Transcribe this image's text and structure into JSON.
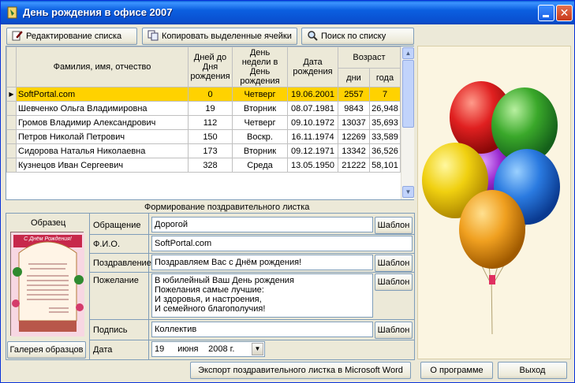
{
  "window": {
    "title": "День рождения в офисе 2007"
  },
  "toolbar": {
    "edit_list": "Редактирование списка",
    "copy_cells": "Копировать выделенные ячейки",
    "search": "Поиск по списку"
  },
  "grid": {
    "headers": {
      "name": "Фамилия, имя, отчество",
      "days_to_bday": "Дней до Дня рождения",
      "weekday": "День недели в День рождения",
      "birth_date": "Дата рождения",
      "age": "Возраст",
      "age_days": "дни",
      "age_years": "года"
    },
    "rows": [
      {
        "name": "SoftPortal.com",
        "days": "0",
        "weekday": "Четверг",
        "date": "19.06.2001",
        "age_days": "2557",
        "age_years": "7"
      },
      {
        "name": "Шевченко Ольга Владимировна",
        "days": "19",
        "weekday": "Вторник",
        "date": "08.07.1981",
        "age_days": "9843",
        "age_years": "26,948"
      },
      {
        "name": "Громов Владимир Александрович",
        "days": "112",
        "weekday": "Четверг",
        "date": "09.10.1972",
        "age_days": "13037",
        "age_years": "35,693"
      },
      {
        "name": "Петров Николай Петрович",
        "days": "150",
        "weekday": "Воскр.",
        "date": "16.11.1974",
        "age_days": "12269",
        "age_years": "33,589"
      },
      {
        "name": "Сидорова Наталья Николаевна",
        "days": "173",
        "weekday": "Вторник",
        "date": "09.12.1971",
        "age_days": "13342",
        "age_years": "36,526"
      },
      {
        "name": "Кузнецов Иван Сергеевич",
        "days": "328",
        "weekday": "Среда",
        "date": "13.05.1950",
        "age_days": "21222",
        "age_years": "58,101"
      }
    ]
  },
  "card": {
    "section_title": "Формирование поздравительного листка",
    "sample_label": "Образец",
    "gallery_button": "Галерея образцов",
    "template_button": "Шаблон",
    "fields": {
      "greeting_label": "Обращение",
      "greeting_value": "Дорогой",
      "fio_label": "Ф.И.О.",
      "fio_value": "SoftPortal.com",
      "congrats_label": "Поздравление",
      "congrats_value": "Поздравляем Вас с Днём рождения!",
      "wish_label": "Пожелание",
      "wish_value": "В юбилейный Ваш День рождения\nПожелания самые лучшие:\nИ здоровья, и настроения,\nИ семейного благополучия!",
      "signature_label": "Подпись",
      "signature_value": "Коллектив",
      "date_label": "Дата",
      "date_day": "19",
      "date_month": "июня",
      "date_year": "2008 г."
    },
    "sample_card": {
      "header": "С Днём Рождения!"
    }
  },
  "footer": {
    "export_button": "Экспорт поздравительного листка в Microsoft Word",
    "about_button": "О программе",
    "exit_button": "Выход"
  },
  "colors": {
    "selected_row": "#ffd200",
    "balloon_panel": "#fbf5e1",
    "titlebar": "#0a5fd8"
  }
}
